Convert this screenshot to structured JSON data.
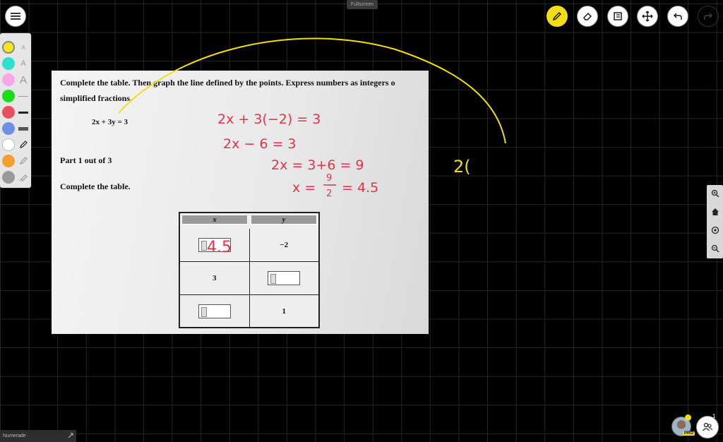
{
  "header": {
    "fullscreen_label": "Fullscreen"
  },
  "toolbar": {
    "tools": [
      {
        "name": "pen",
        "icon": "pencil-icon",
        "active": true
      },
      {
        "name": "eraser",
        "icon": "eraser-icon",
        "active": false
      },
      {
        "name": "slides",
        "icon": "slides-icon",
        "active": false
      },
      {
        "name": "move",
        "icon": "move-icon",
        "active": false
      },
      {
        "name": "undo",
        "icon": "undo-icon",
        "active": false
      },
      {
        "name": "redo",
        "icon": "redo-icon",
        "active": false,
        "disabled": true
      }
    ],
    "accent_color": "#f2de15"
  },
  "palette": {
    "colors": [
      "#f7e51e",
      "#2ee0d0",
      "#f7a6e8",
      "#19dd19",
      "#e9505f",
      "#7090e6",
      "#ffffff",
      "#f4a030",
      "#9a9a9a"
    ],
    "selected_index": 0
  },
  "document": {
    "instruction_line1": "Complete the table. Then graph the line defined by the points. Express numbers as integers o",
    "instruction_line2": "simplified fractions.",
    "equation": "2x + 3y = 3",
    "part": "Part 1 out of 3",
    "subtask": "Complete the table.",
    "table": {
      "headers": [
        "x",
        "y"
      ],
      "rows": [
        [
          "",
          "−2"
        ],
        [
          "3",
          ""
        ],
        [
          "",
          "1"
        ]
      ]
    }
  },
  "handwriting": {
    "red_lines": [
      "2x + 3(−2) = 3",
      "2x − 6 = 3",
      "2x = 3+6 = 9"
    ],
    "red_x_prefix": "x =",
    "red_fraction_num": "9",
    "red_fraction_den": "2",
    "red_x_result": "= 4.5",
    "red_table_value": "4.5",
    "yellow_note": "2(",
    "red_color": "#e0334a",
    "yellow_color": "#f2de15"
  },
  "right_panel": {
    "icons": [
      "zoom-in-icon",
      "home-icon",
      "target-icon",
      "zoom-out-icon"
    ]
  },
  "status": {
    "label": "Numerade"
  },
  "users": {
    "count": "1",
    "badge": "PRO"
  }
}
